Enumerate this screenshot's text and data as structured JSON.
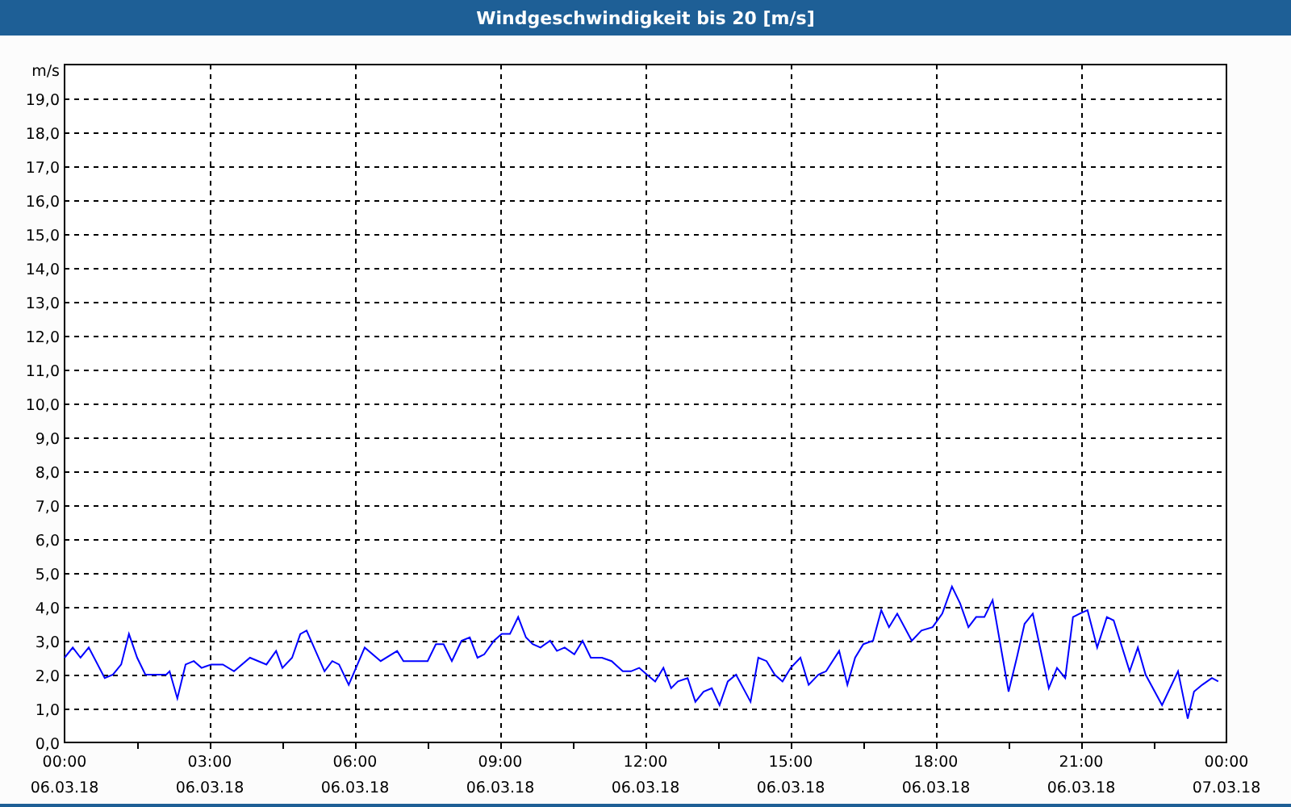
{
  "window": {
    "title": "Windgeschwindigkeit bis 20 [m/s]"
  },
  "chart": {
    "x_dates": [
      "06.03.18",
      "06.03.18",
      "06.03.18",
      "06.03.18",
      "06.03.18",
      "06.03.18",
      "06.03.18",
      "06.03.18",
      "07.03.18"
    ],
    "chart_data": {
      "type": "line",
      "grid": true,
      "ylabel": "m/s",
      "xlim": [
        0,
        24
      ],
      "ylim": [
        0,
        20
      ],
      "xticks": [
        {
          "value": 0,
          "label": "00:00"
        },
        {
          "value": 3,
          "label": "03:00"
        },
        {
          "value": 6,
          "label": "06:00"
        },
        {
          "value": 9,
          "label": "09:00"
        },
        {
          "value": 12,
          "label": "12:00"
        },
        {
          "value": 15,
          "label": "15:00"
        },
        {
          "value": 18,
          "label": "18:00"
        },
        {
          "value": 21,
          "label": "21:00"
        },
        {
          "value": 24,
          "label": "00:00"
        }
      ],
      "yticks": [
        {
          "value": 0,
          "label": "0,0"
        },
        {
          "value": 1,
          "label": "1,0"
        },
        {
          "value": 2,
          "label": "2,0"
        },
        {
          "value": 3,
          "label": "3,0"
        },
        {
          "value": 4,
          "label": "4,0"
        },
        {
          "value": 5,
          "label": "5,0"
        },
        {
          "value": 6,
          "label": "6,0"
        },
        {
          "value": 7,
          "label": "7,0"
        },
        {
          "value": 8,
          "label": "8,0"
        },
        {
          "value": 9,
          "label": "9,0"
        },
        {
          "value": 10,
          "label": "10,0"
        },
        {
          "value": 11,
          "label": "11,0"
        },
        {
          "value": 12,
          "label": "12,0"
        },
        {
          "value": 13,
          "label": "13,0"
        },
        {
          "value": 14,
          "label": "14,0"
        },
        {
          "value": 15,
          "label": "15,0"
        },
        {
          "value": 16,
          "label": "16,0"
        },
        {
          "value": 17,
          "label": "17,0"
        },
        {
          "value": 18,
          "label": "18,0"
        },
        {
          "value": 19,
          "label": "19,0"
        }
      ],
      "x": [
        0,
        0.17,
        0.33,
        0.5,
        0.83,
        1.0,
        1.17,
        1.33,
        1.5,
        1.67,
        2.1,
        2.17,
        2.33,
        2.5,
        2.67,
        2.83,
        3.03,
        3.27,
        3.5,
        3.83,
        4.17,
        4.37,
        4.5,
        4.7,
        4.87,
        5.0,
        5.37,
        5.53,
        5.67,
        5.87,
        6.2,
        6.53,
        6.87,
        7.0,
        7.33,
        7.5,
        7.67,
        7.83,
        8.0,
        8.2,
        8.37,
        8.53,
        8.67,
        8.87,
        9.03,
        9.2,
        9.37,
        9.53,
        9.67,
        9.83,
        10.03,
        10.17,
        10.33,
        10.53,
        10.7,
        10.87,
        11.1,
        11.3,
        11.53,
        11.7,
        11.87,
        12.03,
        12.2,
        12.37,
        12.53,
        12.67,
        12.87,
        13.03,
        13.2,
        13.37,
        13.53,
        13.7,
        13.87,
        14.17,
        14.33,
        14.5,
        14.67,
        14.83,
        15.0,
        15.2,
        15.37,
        15.57,
        15.73,
        16.0,
        16.17,
        16.33,
        16.5,
        16.7,
        16.87,
        17.03,
        17.2,
        17.5,
        17.7,
        17.93,
        18.13,
        18.33,
        18.5,
        18.67,
        18.83,
        19.0,
        19.17,
        19.5,
        19.67,
        19.83,
        20.0,
        20.33,
        20.5,
        20.67,
        20.83,
        20.97,
        21.13,
        21.33,
        21.53,
        21.67,
        22.0,
        22.17,
        22.33,
        22.67,
        23.0,
        23.2,
        23.33,
        23.5,
        23.7,
        23.83
      ],
      "series": [
        {
          "color": "#0000ff",
          "values": [
            2.5,
            2.8,
            2.5,
            2.8,
            1.9,
            2.0,
            2.3,
            3.2,
            2.5,
            2.0,
            2.0,
            2.1,
            1.3,
            2.3,
            2.4,
            2.2,
            2.3,
            2.3,
            2.1,
            2.5,
            2.3,
            2.7,
            2.2,
            2.5,
            3.2,
            3.3,
            2.1,
            2.4,
            2.3,
            1.7,
            2.8,
            2.4,
            2.7,
            2.4,
            2.4,
            2.4,
            2.9,
            2.9,
            2.4,
            3.0,
            3.1,
            2.5,
            2.6,
            3.0,
            3.2,
            3.2,
            3.7,
            3.1,
            2.9,
            2.8,
            3.0,
            2.7,
            2.8,
            2.6,
            3.0,
            2.5,
            2.5,
            2.4,
            2.1,
            2.1,
            2.2,
            2.0,
            1.8,
            2.2,
            1.6,
            1.8,
            1.9,
            1.2,
            1.5,
            1.6,
            1.1,
            1.8,
            2.0,
            1.2,
            2.5,
            2.4,
            2.0,
            1.8,
            2.2,
            2.5,
            1.7,
            2.0,
            2.1,
            2.7,
            1.7,
            2.5,
            2.9,
            3.0,
            3.9,
            3.4,
            3.8,
            3.0,
            3.3,
            3.4,
            3.8,
            4.6,
            4.1,
            3.4,
            3.7,
            3.7,
            4.2,
            1.5,
            2.5,
            3.5,
            3.8,
            1.6,
            2.2,
            1.9,
            3.7,
            3.8,
            3.9,
            2.8,
            3.7,
            3.6,
            2.1,
            2.8,
            2.0,
            1.1,
            2.1,
            0.7,
            1.5,
            1.7,
            1.9,
            1.8
          ]
        }
      ]
    }
  }
}
